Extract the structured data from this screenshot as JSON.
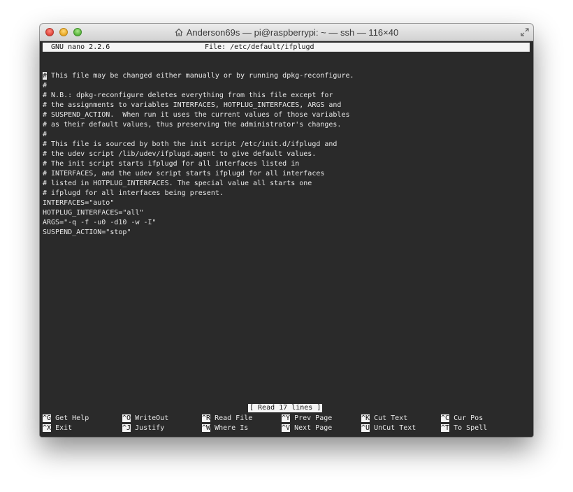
{
  "window": {
    "title": "Anderson69s — pi@raspberrypi: ~ — ssh — 116×40"
  },
  "nano": {
    "version": "GNU nano 2.2.6",
    "file_label": "File: /etc/default/ifplugd",
    "status": "[ Read 17 lines ]",
    "lines": [
      "",
      "# This file may be changed either manually or by running dpkg-reconfigure.",
      "#",
      "# N.B.: dpkg-reconfigure deletes everything from this file except for",
      "# the assignments to variables INTERFACES, HOTPLUG_INTERFACES, ARGS and",
      "# SUSPEND_ACTION.  When run it uses the current values of those variables",
      "# as their default values, thus preserving the administrator's changes.",
      "#",
      "# This file is sourced by both the init script /etc/init.d/ifplugd and",
      "# the udev script /lib/udev/ifplugd.agent to give default values.",
      "# The init script starts ifplugd for all interfaces listed in",
      "# INTERFACES, and the udev script starts ifplugd for all interfaces",
      "# listed in HOTPLUG_INTERFACES. The special value all starts one",
      "# ifplugd for all interfaces being present.",
      "INTERFACES=\"auto\"",
      "HOTPLUG_INTERFACES=\"all\"",
      "ARGS=\"-q -f -u0 -d10 -w -I\"",
      "SUSPEND_ACTION=\"stop\""
    ],
    "shortcuts": [
      {
        "key": "^G",
        "label": "Get Help"
      },
      {
        "key": "^O",
        "label": "WriteOut"
      },
      {
        "key": "^R",
        "label": "Read File"
      },
      {
        "key": "^Y",
        "label": "Prev Page"
      },
      {
        "key": "^K",
        "label": "Cut Text"
      },
      {
        "key": "^C",
        "label": "Cur Pos"
      },
      {
        "key": "^X",
        "label": "Exit"
      },
      {
        "key": "^J",
        "label": "Justify"
      },
      {
        "key": "^W",
        "label": "Where Is"
      },
      {
        "key": "^V",
        "label": "Next Page"
      },
      {
        "key": "^U",
        "label": "UnCut Text"
      },
      {
        "key": "^T",
        "label": "To Spell"
      }
    ]
  },
  "icons": {
    "home": "home-icon",
    "resize": "fullscreen-icon",
    "close": "close-button",
    "minimize": "minimize-button",
    "zoom": "zoom-button"
  }
}
